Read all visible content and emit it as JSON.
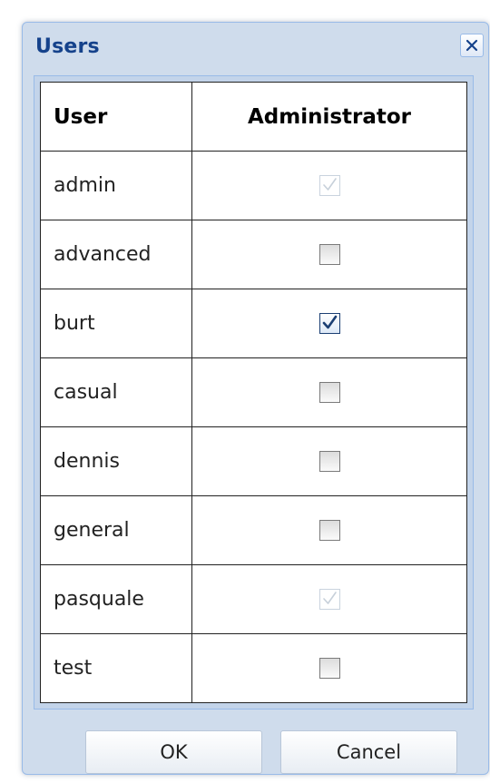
{
  "dialog": {
    "title": "Users",
    "close_icon": "close-icon"
  },
  "grid": {
    "headers": {
      "user": "User",
      "administrator": "Administrator"
    },
    "rows": [
      {
        "user": "admin",
        "administrator": true,
        "disabled": true
      },
      {
        "user": "advanced",
        "administrator": false,
        "disabled": false
      },
      {
        "user": "burt",
        "administrator": true,
        "disabled": false
      },
      {
        "user": "casual",
        "administrator": false,
        "disabled": false
      },
      {
        "user": "dennis",
        "administrator": false,
        "disabled": false
      },
      {
        "user": "general",
        "administrator": false,
        "disabled": false
      },
      {
        "user": "pasquale",
        "administrator": true,
        "disabled": true
      },
      {
        "user": "test",
        "administrator": false,
        "disabled": false
      }
    ]
  },
  "buttons": {
    "ok_label": "OK",
    "cancel_label": "Cancel"
  },
  "colors": {
    "title": "#15428b",
    "window_background": "#cfdcec",
    "border": "#99bbe8"
  }
}
